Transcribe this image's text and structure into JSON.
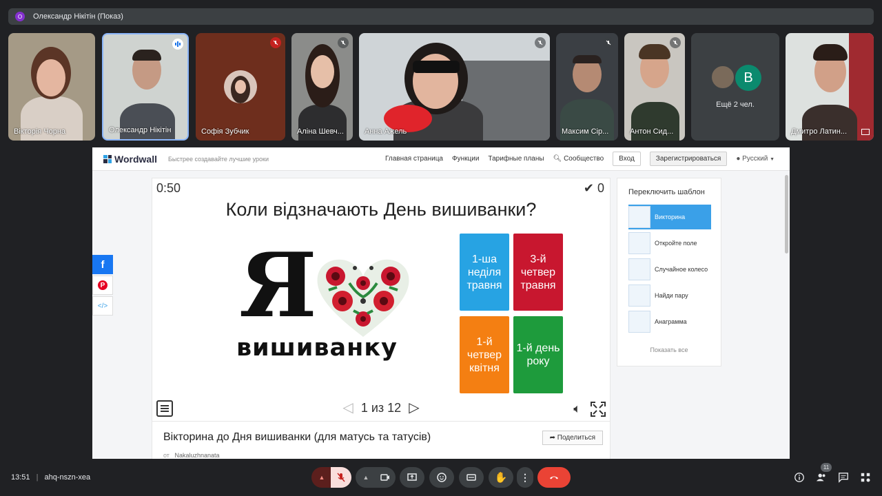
{
  "presentation_bar": {
    "badge": "О",
    "title": "Олександр Нікітін (Показ)"
  },
  "participants": [
    {
      "name": "Вікторія Чорна"
    },
    {
      "name": "Олександр Нікітін"
    },
    {
      "name": "Софія Зубчик"
    },
    {
      "name": "Аліна Шевч..."
    },
    {
      "name": "Анна Ажель"
    },
    {
      "name": "Максим Сір..."
    },
    {
      "name": "Антон Сид..."
    },
    {
      "name": "Дмитро Латин..."
    }
  ],
  "others_tile": {
    "avatar_letter": "В",
    "label": "Ещё 2 чел."
  },
  "wordwall": {
    "logo": "Wordwall",
    "tagline": "Быстрее создавайте лучшие уроки",
    "nav": {
      "home": "Главная страница",
      "features": "Функции",
      "plans": "Тарифные планы",
      "community": "Сообщество",
      "login": "Вход",
      "register": "Зарегистрироваться",
      "language": "Русский"
    },
    "game": {
      "timer": "0:50",
      "score": "0",
      "question": "Коли відзначають День вишиванки?",
      "picture_big_letter": "Я",
      "picture_word": "вишиванку",
      "answers": [
        {
          "text": "1-ша неділя травня",
          "color": "#27a3e3"
        },
        {
          "text": "3-й четвер травня",
          "color": "#c8172f"
        },
        {
          "text": "1-й четвер квітня",
          "color": "#f47f12"
        },
        {
          "text": "1-й день року",
          "color": "#1e9b3c"
        }
      ],
      "pager": "1 из 12"
    },
    "activity": {
      "title": "Вікторина до Дня вишиванки (для матусь та татусів)",
      "author_prefix": "от",
      "author": "Nakaluzhnanata",
      "share": "Поделиться"
    },
    "templates": {
      "title": "Переключить шаблон",
      "items": [
        "Викторина",
        "Откройте поле",
        "Случайное колесо",
        "Найди пару",
        "Анаграмма"
      ],
      "show_all": "Показать все"
    }
  },
  "bottom": {
    "time": "13:51",
    "meeting_code": "ahq-nszn-xea",
    "participant_count": "11"
  }
}
